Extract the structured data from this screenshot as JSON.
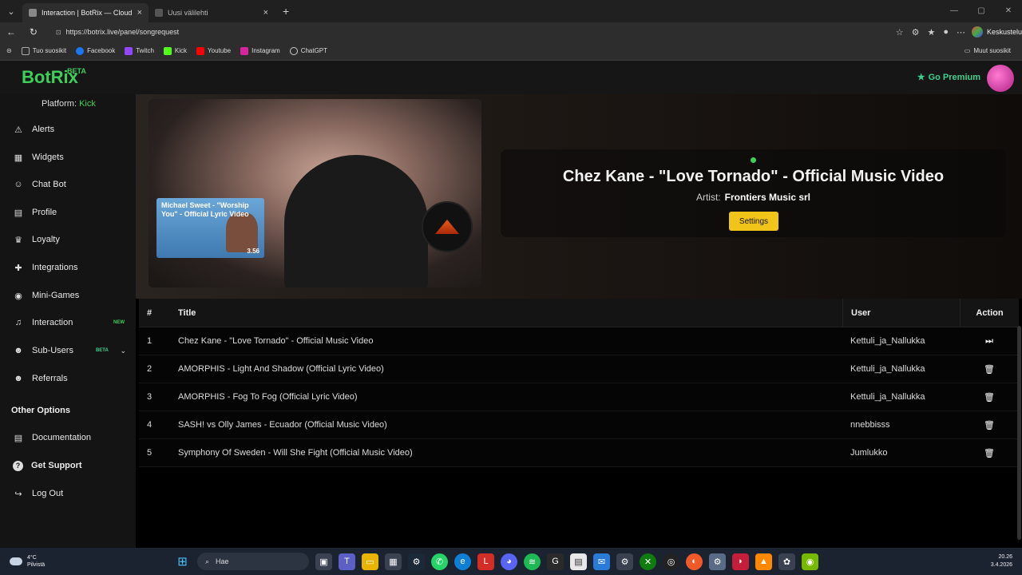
{
  "browser": {
    "tabs": [
      {
        "title": "Interaction | BotRix — Cloud",
        "active": true
      },
      {
        "title": "Uusi välilehti",
        "active": false
      }
    ],
    "url": "https://botrix.live/panel/songrequest",
    "profile_label": "Keskustelu",
    "bookmarks": [
      {
        "label": "Tuo suosikit",
        "color": "#aaaaaa"
      },
      {
        "label": "Facebook",
        "color": "#1877f2"
      },
      {
        "label": "Twitch",
        "color": "#9146ff"
      },
      {
        "label": "Kick",
        "color": "#53fc18"
      },
      {
        "label": "Youtube",
        "color": "#ff0000"
      },
      {
        "label": "Instagram",
        "color": "#d6249f"
      },
      {
        "label": "ChatGPT",
        "color": "#cccccc"
      }
    ],
    "other_bookmarks": "Muut suosikit"
  },
  "app": {
    "logo": "BotRix",
    "logo_badge": "BETA",
    "premium_label": "Go Premium",
    "platform_label": "Platform:",
    "platform_value": "Kick",
    "sidebar": {
      "items": [
        {
          "label": "Alerts",
          "icon": "warning-icon",
          "glyph": "⚠"
        },
        {
          "label": "Widgets",
          "icon": "grid-icon",
          "glyph": "▦"
        },
        {
          "label": "Chat Bot",
          "icon": "robot-icon",
          "glyph": "☺"
        },
        {
          "label": "Profile",
          "icon": "id-card-icon",
          "glyph": "▤"
        },
        {
          "label": "Loyalty",
          "icon": "trophy-icon",
          "glyph": "♛"
        },
        {
          "label": "Integrations",
          "icon": "puzzle-icon",
          "glyph": "✚"
        },
        {
          "label": "Mini-Games",
          "icon": "gamepad-icon",
          "glyph": "◉"
        },
        {
          "label": "Interaction",
          "icon": "music-icon",
          "glyph": "♫",
          "badge": "NEW"
        },
        {
          "label": "Sub-Users",
          "icon": "users-icon",
          "glyph": "☻",
          "badge": "BETA",
          "expandable": true
        },
        {
          "label": "Referrals",
          "icon": "user-group-icon",
          "glyph": "☻"
        }
      ],
      "other_title": "Other Options",
      "other_items": [
        {
          "label": "Documentation",
          "icon": "book-icon",
          "glyph": "▤"
        },
        {
          "label": "Get Support",
          "icon": "question-icon",
          "glyph": "?"
        },
        {
          "label": "Log Out",
          "icon": "logout-icon",
          "glyph": "↪"
        }
      ]
    },
    "player": {
      "next_thumb_title": "Michael Sweet - \"Worship You\" - Official Lyric Video",
      "next_thumb_duration": "3.56"
    },
    "now_playing": {
      "title": "Chez Kane - \"Love Tornado\" - Official Music Video",
      "artist_label": "Artist:",
      "artist": "Frontiers Music srl",
      "settings_label": "Settings"
    },
    "queue": {
      "columns": [
        "#",
        "Title",
        "User",
        "Action"
      ],
      "rows": [
        {
          "num": "1",
          "title": "Chez Kane - \"Love Tornado\" - Official Music Video",
          "user": "Kettuli_ja_Nallukka",
          "action": "skip"
        },
        {
          "num": "2",
          "title": "AMORPHIS - Light And Shadow (Official Lyric Video)",
          "user": "Kettuli_ja_Nallukka",
          "action": "delete"
        },
        {
          "num": "3",
          "title": "AMORPHIS - Fog To Fog (Official Lyric Video)",
          "user": "Kettuli_ja_Nallukka",
          "action": "delete"
        },
        {
          "num": "4",
          "title": "SASH! vs Olly James - Ecuador (Official Music Video)",
          "user": "nnebbisss",
          "action": "delete"
        },
        {
          "num": "5",
          "title": "Symphony Of Sweden - Will She Fight (Official Music Video)",
          "user": "Jumlukko",
          "action": "delete"
        }
      ]
    }
  },
  "taskbar": {
    "weather_temp": "4°C",
    "weather_desc": "Pilvistä",
    "search_placeholder": "Hae",
    "time": "20.26",
    "date": "3.4.2026"
  }
}
